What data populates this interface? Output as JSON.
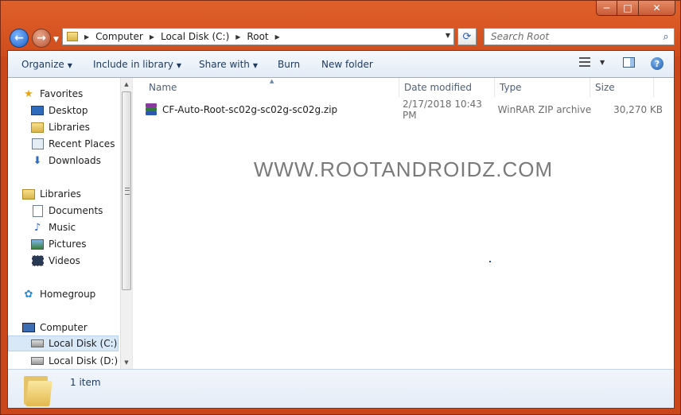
{
  "window": {
    "caption_buttons": {
      "minimize": "─",
      "maximize": "□",
      "close": "✕"
    }
  },
  "nav": {
    "back_glyph": "←",
    "forward_glyph": "→"
  },
  "address": {
    "crumbs": [
      "Computer",
      "Local Disk (C:)",
      "Root"
    ]
  },
  "search": {
    "placeholder": "Search Root"
  },
  "toolbar": {
    "organize": "Organize",
    "include_in_library": "Include in library",
    "share_with": "Share with",
    "burn": "Burn",
    "new_folder": "New folder",
    "help_glyph": "?"
  },
  "sidebar": {
    "favorites": {
      "label": "Favorites",
      "icon": "star-icon"
    },
    "favorites_items": [
      {
        "label": "Desktop",
        "icon": "desktop-icon"
      },
      {
        "label": "Libraries",
        "icon": "libraries-icon"
      },
      {
        "label": "Recent Places",
        "icon": "recent-places-icon"
      },
      {
        "label": "Downloads",
        "icon": "downloads-icon"
      }
    ],
    "libraries": {
      "label": "Libraries",
      "icon": "libraries-icon"
    },
    "libraries_items": [
      {
        "label": "Documents",
        "icon": "documents-icon"
      },
      {
        "label": "Music",
        "icon": "music-icon"
      },
      {
        "label": "Pictures",
        "icon": "pictures-icon"
      },
      {
        "label": "Videos",
        "icon": "videos-icon"
      }
    ],
    "homegroup": {
      "label": "Homegroup",
      "icon": "homegroup-icon"
    },
    "computer": {
      "label": "Computer",
      "icon": "computer-icon"
    },
    "computer_items": [
      {
        "label": "Local Disk (C:)",
        "icon": "drive-icon",
        "selected": true
      },
      {
        "label": "Local Disk (D:)",
        "icon": "drive-icon",
        "selected": false
      }
    ]
  },
  "file_list": {
    "columns": [
      "Name",
      "Date modified",
      "Type",
      "Size"
    ],
    "rows": [
      {
        "name": "CF-Auto-Root-sc02g-sc02g-sc02g.zip",
        "date_modified": "2/17/2018 10:43 PM",
        "type": "WinRAR ZIP archive",
        "size": "30,270 KB",
        "icon": "winrar-archive-icon"
      }
    ]
  },
  "watermark": "WWW.ROOTANDROIDZ.COM",
  "details_pane": {
    "count": "1 item",
    "icon": "folder-icon"
  },
  "colors": {
    "frame": "#c9471a",
    "toolbar_text": "#1e395b",
    "selection": "#d9e8f7"
  }
}
